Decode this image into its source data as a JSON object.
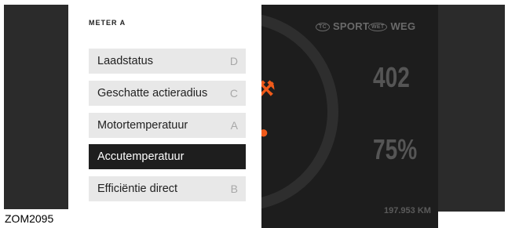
{
  "menu": {
    "title": "METER A",
    "items": [
      {
        "label": "Laadstatus",
        "key": "D",
        "selected": false
      },
      {
        "label": "Geschatte actieradius",
        "key": "C",
        "selected": false
      },
      {
        "label": "Motortemperatuur",
        "key": "A",
        "selected": false
      },
      {
        "label": "Accutemperatuur",
        "key": "",
        "selected": true
      },
      {
        "label": "Efficiëntie direct",
        "key": "B",
        "selected": false
      }
    ]
  },
  "dash": {
    "tc_badge": "TC",
    "sport_label": "SPORT",
    "wet_badge": "WET",
    "weg_label": "WEG",
    "range_value": "402",
    "battery_value": "75%",
    "odometer": "197.953 KM"
  },
  "figure_code": "ZOM2095",
  "colors": {
    "accent": "#f05a1a",
    "selected_bg": "#1e1e1e",
    "item_bg": "#e8e8e8"
  }
}
